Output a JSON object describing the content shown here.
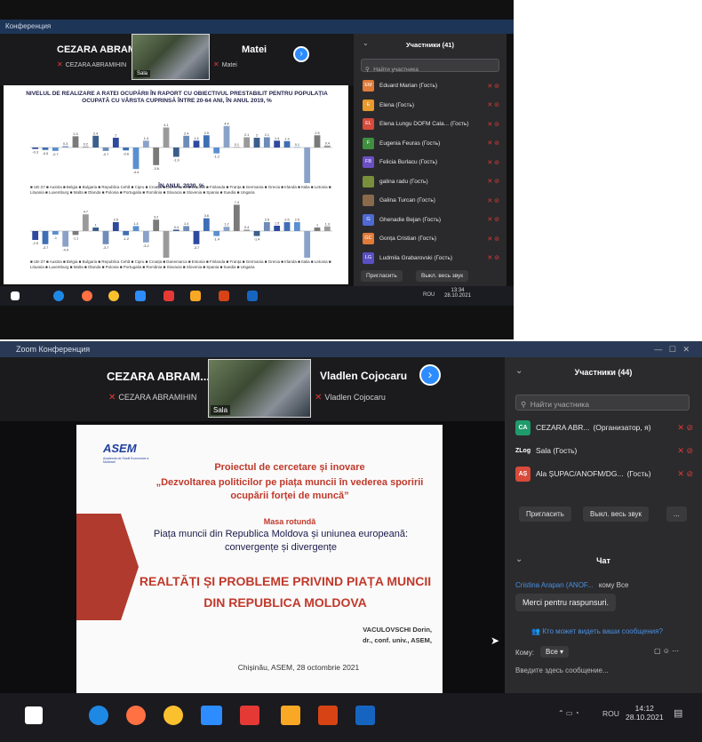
{
  "photo1": {
    "app_title": "Конференция",
    "video": {
      "left_name": "CEZARA ABRAM...",
      "left_sub": "CEZARA ABRAMIHIN",
      "tile_label": "Sala",
      "right_name": "Matei",
      "right_sub": "Matei"
    },
    "slide": {
      "title_2019": "NIVELUL DE REALIZARE A RATEI OCUPĂRII ÎN RAPORT CU OBIECTIVUL PRESTABILIT PENTRU POPULAȚIA OCUPATĂ CU VÂRSTA CUPRINSĂ ÎNTRE 20-64 ANI, ÎN ANUL 2019, %",
      "title_2020": "ÎN ANUL 2020, %"
    },
    "participants": {
      "header": "Участники (41)",
      "search_placeholder": "Найти участника",
      "items": [
        {
          "initials": "EM",
          "name": "Eduard Marian (Гость)",
          "color": "#e07b39"
        },
        {
          "initials": "E",
          "name": "Elena (Гость)",
          "color": "#e89a2c"
        },
        {
          "initials": "EL",
          "name": "Elena Lungu DOFM Cala... (Гость)",
          "color": "#d84a3a"
        },
        {
          "initials": "F",
          "name": "Eugenia Feuras (Гость)",
          "color": "#3f8f3f"
        },
        {
          "initials": "FB",
          "name": "Felicia Burlacu (Гость)",
          "color": "#6a4fc4"
        },
        {
          "initials": "",
          "name": "galina radu (Гость)",
          "color": "#7a8f3a"
        },
        {
          "initials": "",
          "name": "Galina Turcan (Гость)",
          "color": "#8a6a4a"
        },
        {
          "initials": "G",
          "name": "Ghenadie Bejan (Гость)",
          "color": "#4f6ad4"
        },
        {
          "initials": "GC",
          "name": "Gonța Cristian (Гость)",
          "color": "#e07b39"
        },
        {
          "initials": "LG",
          "name": "Ludmila Grabarovski (Гость)",
          "color": "#5a4fc4"
        }
      ],
      "invite": "Пригласить",
      "mute_all": "Выкл. весь звук"
    },
    "clock": {
      "time": "13:34",
      "date": "28.10.2021",
      "lang": "ROU"
    }
  },
  "photo2": {
    "app_title": "Zoom Конференция",
    "video": {
      "left_name": "CEZARA ABRAM...",
      "left_sub": "CEZARA ABRAMIHIN",
      "tile_label": "Sala",
      "right_name": "Vladlen Cojocaru",
      "right_sub": "Vladlen Cojocaru"
    },
    "slide": {
      "logo": "ASEM",
      "logo_sub": "Academia de Studii Economice a Moldovei",
      "project": "Proiectul de cercetare și inovare",
      "project_title": "„Dezvoltarea politicilor pe piața muncii în vederea sporirii ocupării forței de muncă”",
      "masa": "Masa rotundă",
      "theme": "Piața muncii din Republica Moldova și uniunea europeană: convergențe și divergențe",
      "headline": "REALTĂȚI ȘI PROBLEME PRIVIND PIAȚA MUNCII DIN REPUBLICA MOLDOVA",
      "author": "VACULOVSCHI Dorin,",
      "author_title": "dr., conf. univ., ASEM,",
      "place": "Chișinău, ASEM, 28 octombrie 2021"
    },
    "participants": {
      "header": "Участники (44)",
      "search_placeholder": "Найти участника",
      "items": [
        {
          "initials": "CA",
          "name": "CEZARA ABR...",
          "role": "(Организатор, я)",
          "color": "#1f9a6b"
        },
        {
          "initials": "ZLog",
          "name": "Sala (Гость)",
          "role": "",
          "color": "#2b2b2d"
        },
        {
          "initials": "AȘ",
          "name": "Ala ȘUPAC/ANOFM/DG...",
          "role": "(Гость)",
          "color": "#d84a3a"
        }
      ],
      "invite": "Пригласить",
      "mute_all": "Выкл. весь звук",
      "more": "..."
    },
    "chat": {
      "header": "Чат",
      "sender": "Cristina Arapan (ANOF...",
      "to": "кому Все",
      "message": "Merci pentru raspunsuri.",
      "who_can_see": "Кто может видеть ваши сообщения?",
      "to_label": "Кому:",
      "to_value": "Все",
      "input_placeholder": "Введите здесь сообщение..."
    },
    "clock": {
      "time": "14:12",
      "date": "28.10.2021",
      "lang": "ROU"
    }
  },
  "chart_data": [
    {
      "type": "bar",
      "title": "NIVELUL DE REALIZARE A RATEI OCUPĂRII ÎN RAPORT CU OBIECTIVUL PRESTABILIT PENTRU POPULAȚIA OCUPATĂ CU VÂRSTA CUPRINSĂ ÎNTRE 20-64 ANI, ÎN ANUL 2019, %",
      "values": [
        -0.3,
        -0.5,
        -0.7,
        0.3,
        2.3,
        0.2,
        2.4,
        -0.7,
        2.0,
        -0.6,
        -4.4,
        1.4,
        -3.6,
        4.1,
        -1.9,
        2.4,
        1.4,
        2.5,
        -1.2,
        4.4,
        0.1,
        2.1,
        2.0,
        2.1,
        1.4,
        1.3,
        0.1,
        -8.2,
        2.5,
        0.4
      ]
    },
    {
      "type": "bar",
      "title": "ÎN ANUL 2020, %",
      "values": [
        -2.5,
        -3.7,
        -1.0,
        -4.4,
        -1.1,
        4.7,
        1.0,
        -3.7,
        2.5,
        -1.2,
        1.4,
        -3.2,
        3.2,
        -9.4,
        0.4,
        1.4,
        -3.7,
        3.6,
        -1.4,
        1.2,
        7.4,
        0.4,
        -1.4,
        2.5,
        1.5,
        2.5,
        2.5,
        -8.5,
        1.0,
        1.3
      ]
    }
  ]
}
